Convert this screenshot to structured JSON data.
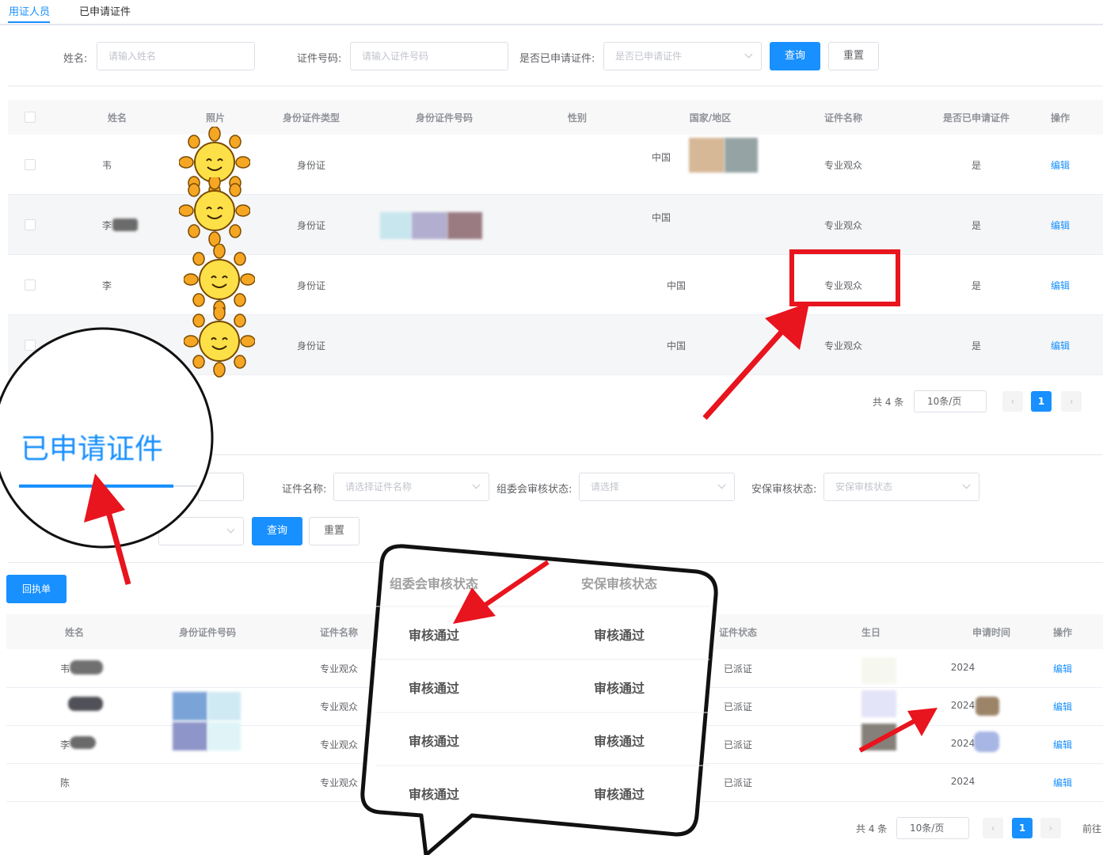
{
  "tabs": [
    "用证人员",
    "已申请证件"
  ],
  "filters1": {
    "name_label": "姓名:",
    "name_placeholder": "请输入姓名",
    "id_label": "证件号码:",
    "id_placeholder": "请输入证件号码",
    "applied_label": "是否已申请证件:",
    "applied_placeholder": "是否已申请证件",
    "search_btn": "查询",
    "reset_btn": "重置"
  },
  "table1": {
    "headers": [
      "姓名",
      "照片",
      "身份证件类型",
      "身份证件号码",
      "性别",
      "国家/地区",
      "证件名称",
      "是否已申请证件",
      "操作"
    ],
    "rows": [
      {
        "name": "韦",
        "id_type": "身份证",
        "country": "中国",
        "cert": "专业观众",
        "applied": "是",
        "action": "编辑"
      },
      {
        "name": "李",
        "id_type": "身份证",
        "country": "中国",
        "cert": "专业观众",
        "applied": "是",
        "action": "编辑"
      },
      {
        "name": "李",
        "id_type": "身份证",
        "country": "中国",
        "cert": "专业观众",
        "applied": "是",
        "action": "编辑"
      },
      {
        "name": "",
        "id_type": "身份证",
        "country": "中国",
        "cert": "专业观众",
        "applied": "是",
        "action": "编辑"
      }
    ]
  },
  "pager1": {
    "total": "共 4 条",
    "size": "10条/页",
    "page": "1"
  },
  "zoom_tab_label": "已申请证件",
  "filters2": {
    "cert_label": "证件名称:",
    "cert_placeholder": "请选择证件名称",
    "org_label": "组委会审核状态:",
    "org_placeholder": "请选择",
    "sec_label": "安保审核状态:",
    "sec_placeholder": "安保审核状态",
    "search_btn": "查询",
    "reset_btn": "重置"
  },
  "receipt_btn": "回执单",
  "table2": {
    "headers": [
      "姓名",
      "身份证件号码",
      "证件名称",
      "证件状态",
      "生日",
      "申请时间",
      "操作"
    ],
    "rows": [
      {
        "name": "韦",
        "cert": "专业观众",
        "status": "已派证",
        "date": "2024",
        "action": "编辑"
      },
      {
        "name": "",
        "cert": "专业观众",
        "status": "已派证",
        "date": "2024",
        "action": "编辑"
      },
      {
        "name": "李",
        "cert": "专业观众",
        "status": "已派证",
        "date": "2024",
        "action": "编辑"
      },
      {
        "name": "陈",
        "cert": "专业观众",
        "status": "已派证",
        "date": "2024",
        "action": "编辑"
      }
    ]
  },
  "pager2": {
    "total": "共 4 条",
    "size": "10条/页",
    "page": "1",
    "goto": "前往"
  },
  "callout": {
    "headers": [
      "组委会审核状态",
      "安保审核状态"
    ],
    "rows": [
      [
        "审核通过",
        "审核通过"
      ],
      [
        "审核通过",
        "审核通过"
      ],
      [
        "审核通过",
        "审核通过"
      ],
      [
        "审核通过",
        "审核通过"
      ]
    ]
  },
  "colors": {
    "accent": "#1890ff",
    "annotation": "#e8141e"
  }
}
